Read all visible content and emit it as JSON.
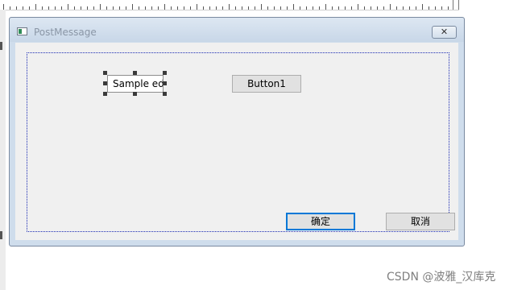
{
  "window": {
    "title": "PostMessage",
    "close_glyph": "✕"
  },
  "controls": {
    "edit_text": "Sample edit",
    "button1_label": "Button1",
    "ok_label": "确定",
    "cancel_label": "取消"
  },
  "watermark": "CSDN @波雅_汉库克",
  "icons": {
    "app": "app-window-icon",
    "close": "close-icon"
  },
  "colors": {
    "title_bar": "#cfddec",
    "client_bg": "#f0f0f0",
    "focus_border": "#0078d7",
    "frame_dotted": "#1b2bb3"
  }
}
